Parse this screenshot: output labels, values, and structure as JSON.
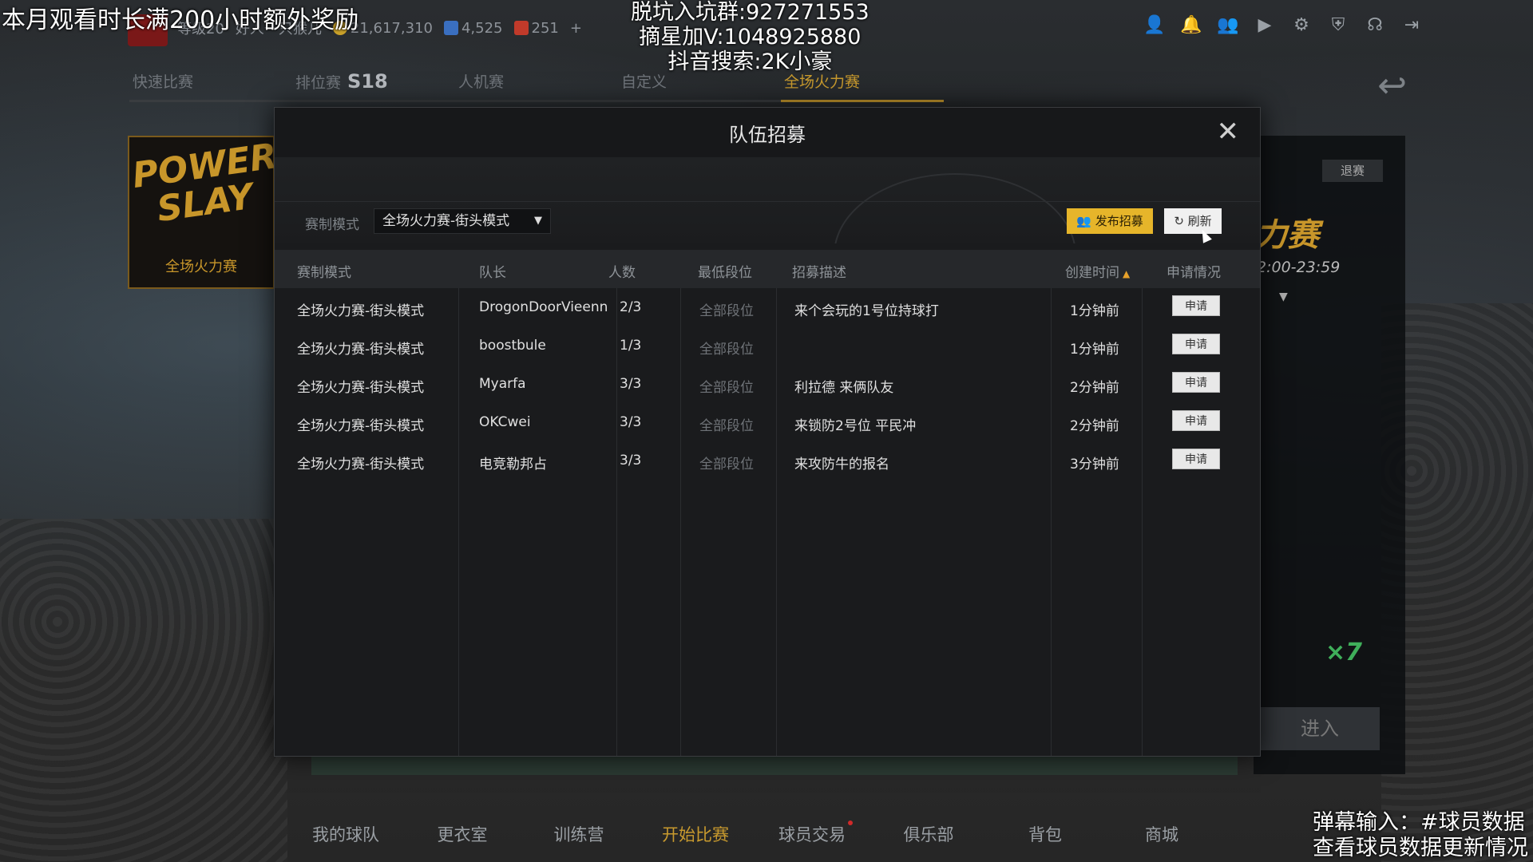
{
  "overlays": {
    "top_left": "本月观看时长满200小时额外奖励",
    "top_center": [
      "脱坑入坑群:927271553",
      "摘星加V:1048925880",
      "抖音搜索:2K小豪"
    ],
    "bottom_right": [
      "弹幕输入：#球员数据",
      "查看球员数据更新情况"
    ]
  },
  "topbar": {
    "level": "等级20",
    "friends": "好人一只猴儿",
    "coins": "21,617,310",
    "stars": "4,525",
    "tickets": "251",
    "plus": "+"
  },
  "tabs": [
    {
      "label": "快速比赛"
    },
    {
      "label": "排位赛",
      "season": "S18"
    },
    {
      "label": "人机赛"
    },
    {
      "label": "自定义"
    },
    {
      "label": "全场火力赛"
    }
  ],
  "left_card": {
    "logo": "POWER SLAY",
    "label": "全场火力赛"
  },
  "right_panel": {
    "quit": "退赛",
    "big": "力赛",
    "time": "2:00-23:59",
    "enter": "进入",
    "mult": "×7"
  },
  "bottom_nav": [
    "我的球队",
    "更衣室",
    "训练营",
    "开始比赛",
    "球员交易",
    "俱乐部",
    "背包",
    "商城"
  ],
  "modal": {
    "title": "队伍招募",
    "close": "✕",
    "filter_label": "赛制模式",
    "filter_value": "全场火力赛-街头模式",
    "publish": "发布招募",
    "refresh": "刷新",
    "headers": {
      "mode": "赛制模式",
      "captain": "队长",
      "count": "人数",
      "rank": "最低段位",
      "desc": "招募描述",
      "created": "创建时间",
      "status": "申请情况"
    },
    "rows": [
      {
        "mode": "全场火力赛-街头模式",
        "captain": "DrogonDoorVieenn",
        "count": "2/3",
        "rank": "全部段位",
        "desc": "来个会玩的1号位持球打",
        "created": "1分钟前",
        "action": "申请"
      },
      {
        "mode": "全场火力赛-街头模式",
        "captain": "boostbule",
        "count": "1/3",
        "rank": "全部段位",
        "desc": "",
        "created": "1分钟前",
        "action": "申请"
      },
      {
        "mode": "全场火力赛-街头模式",
        "captain": "Myarfa",
        "count": "3/3",
        "rank": "全部段位",
        "desc": "利拉德  来俩队友",
        "created": "2分钟前",
        "action": "申请"
      },
      {
        "mode": "全场火力赛-街头模式",
        "captain": "OKCwei",
        "count": "3/3",
        "rank": "全部段位",
        "desc": "来锁防2号位 平民冲",
        "created": "2分钟前",
        "action": "申请"
      },
      {
        "mode": "全场火力赛-街头模式",
        "captain": "电竞勒邦占",
        "count": "3/3",
        "rank": "全部段位",
        "desc": "来攻防牛的报名",
        "created": "3分钟前",
        "action": "申请"
      }
    ]
  },
  "colors": {
    "accent": "#c89a2e",
    "publish_bg": "#e6b52a",
    "modal_bg": "#1a1b1d"
  }
}
